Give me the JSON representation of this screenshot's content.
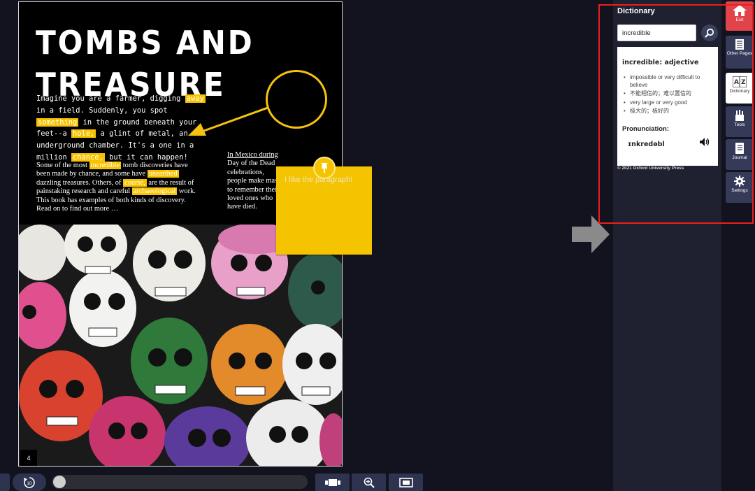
{
  "book": {
    "title_line1": "TOMBS AND",
    "title_line2": "TREASURE",
    "intro": {
      "p1": "Imagine you are a farmer, digging ",
      "w1": "away",
      "p2": " in a field. Suddenly, you spot ",
      "w2": "something",
      "p3": " in the ground beneath your feet--a ",
      "w3": "hole,",
      "p4": " a glint of metal, an underground chamber. It's a one in a million ",
      "w4": "chance,",
      "p5": " but it can happen!"
    },
    "body": {
      "p1": "Some of the most ",
      "w1": "incredible",
      "p2": " tomb discoveries have been made by chance, and some have ",
      "w2": "unearthed",
      "p3": " dazzling treasures. Others, of ",
      "w3": "course,",
      "p4": " are the result of painstaking research and careful ",
      "w4": "archaeological",
      "p5": " work. This book has examples of both kinds of discovery. Read on to find out more …"
    },
    "caption": {
      "underlined": "In Mexico during",
      "rest": " Day of the Dead celebrations, people make masks to remember their loved ones who have died."
    },
    "page_number": "4",
    "note_text": "I like the paragraph!"
  },
  "dictionary": {
    "title": "Dictionary",
    "search_value": "incredible",
    "headword": "incredible: adjective",
    "definitions": [
      "impossible or very difficult to believe",
      "不能相信的；难以置信的",
      "very large or very good",
      "极大的；极好的"
    ],
    "pronunciation_label": "Pronunciation:",
    "pronunciation": "ɪnkredəbl",
    "copyright": "© 2021 Oxford University Press"
  },
  "sidebar": {
    "items": [
      {
        "label": "Exit",
        "icon": "home-icon"
      },
      {
        "label": "Other Pages",
        "icon": "pages-icon"
      },
      {
        "label": "Dictionary",
        "icon": "dictionary-icon"
      },
      {
        "label": "Tools",
        "icon": "tools-icon"
      },
      {
        "label": "Journal",
        "icon": "journal-icon"
      },
      {
        "label": "Settings",
        "icon": "gear-icon"
      }
    ]
  },
  "bottom_bar": {
    "replay_label": "10"
  },
  "colors": {
    "highlight": "#f7c200",
    "exit_red": "#e0444a",
    "panel": "#1f2030",
    "button": "#343a58"
  }
}
